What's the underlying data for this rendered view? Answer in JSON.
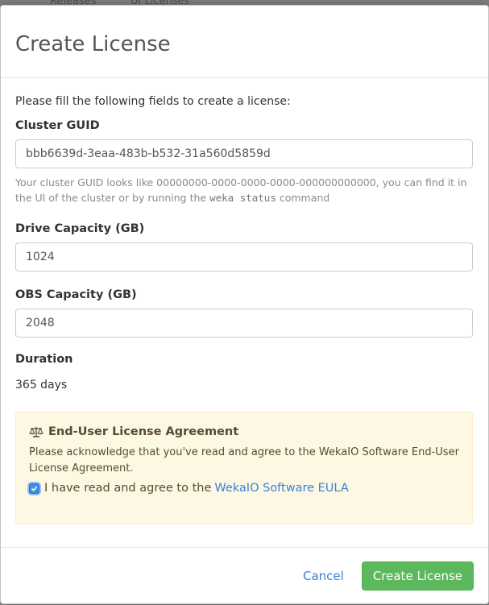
{
  "background": {
    "tabs": [
      "Releases",
      "UI Licenses"
    ]
  },
  "modal": {
    "title": "Create License",
    "intro": "Please fill the following fields to create a license:",
    "cluster_guid": {
      "label": "Cluster GUID",
      "value": "bbb6639d-3eaa-483b-b532-31a560d5859d",
      "help_prefix": "Your cluster GUID looks like 00000000-0000-0000-0000-000000000000, you can find it in the UI of the cluster or by running the ",
      "help_code": "weka status",
      "help_suffix": " command"
    },
    "drive_capacity": {
      "label": "Drive Capacity (GB)",
      "value": "1024"
    },
    "obs_capacity": {
      "label": "OBS Capacity (GB)",
      "value": "2048"
    },
    "duration": {
      "label": "Duration",
      "value": "365 days"
    },
    "eula": {
      "icon": "balance-scale-icon",
      "title": "End-User License Agreement",
      "text": "Please acknowledge that you've read and agree to the WekaIO Software End-User License Agreement.",
      "checkbox_label": "I have read and agree to the",
      "checkbox_checked": true,
      "link_text": "WekaIO Software EULA"
    },
    "footer": {
      "cancel_label": "Cancel",
      "submit_label": "Create License"
    }
  },
  "colors": {
    "primary_button": "#5cb85c",
    "link": "#3b82d6",
    "warning_bg": "#fcf8e3"
  }
}
